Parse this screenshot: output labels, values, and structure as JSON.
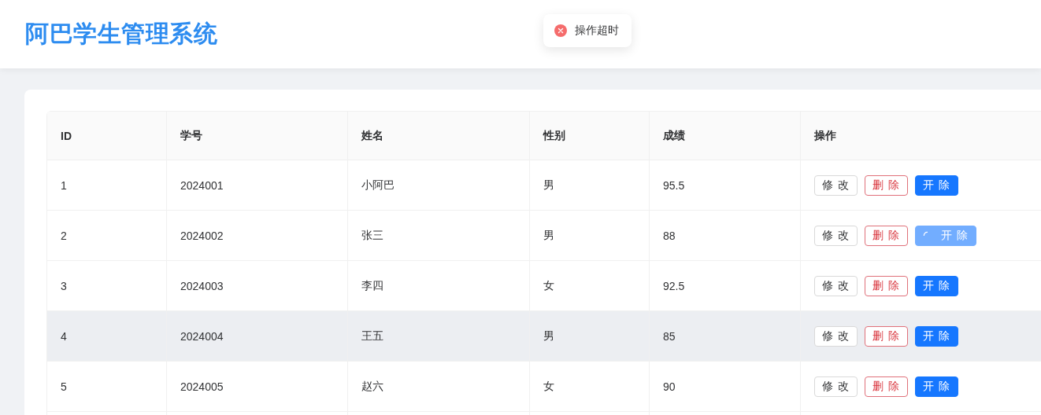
{
  "header": {
    "title": "阿巴学生管理系统"
  },
  "toast": {
    "kind": "error",
    "message": "操作超时"
  },
  "table": {
    "columns": [
      "ID",
      "学号",
      "姓名",
      "性别",
      "成绩",
      "操作"
    ],
    "rows": [
      {
        "cells": [
          "1",
          "2024001",
          "小阿巴",
          "男",
          "95.5"
        ],
        "hovered": false,
        "actions": [
          {
            "label": "修 改",
            "kind": "default"
          },
          {
            "label": "删 除",
            "kind": "danger"
          },
          {
            "label": "开 除",
            "kind": "primary",
            "loading": false
          }
        ]
      },
      {
        "cells": [
          "2",
          "2024002",
          "张三",
          "男",
          "88"
        ],
        "hovered": false,
        "actions": [
          {
            "label": "修 改",
            "kind": "default"
          },
          {
            "label": "删 除",
            "kind": "danger"
          },
          {
            "label": "开 除",
            "kind": "primary",
            "loading": true
          }
        ]
      },
      {
        "cells": [
          "3",
          "2024003",
          "李四",
          "女",
          "92.5"
        ],
        "hovered": false,
        "actions": [
          {
            "label": "修 改",
            "kind": "default"
          },
          {
            "label": "删 除",
            "kind": "danger"
          },
          {
            "label": "开 除",
            "kind": "primary",
            "loading": false
          }
        ]
      },
      {
        "cells": [
          "4",
          "2024004",
          "王五",
          "男",
          "85"
        ],
        "hovered": true,
        "actions": [
          {
            "label": "修 改",
            "kind": "default"
          },
          {
            "label": "删 除",
            "kind": "danger"
          },
          {
            "label": "开 除",
            "kind": "primary",
            "loading": false
          }
        ]
      },
      {
        "cells": [
          "5",
          "2024005",
          "赵六",
          "女",
          "90"
        ],
        "hovered": false,
        "actions": [
          {
            "label": "修 改",
            "kind": "default"
          },
          {
            "label": "删 除",
            "kind": "danger"
          },
          {
            "label": "开 除",
            "kind": "primary",
            "loading": false
          }
        ]
      }
    ]
  }
}
